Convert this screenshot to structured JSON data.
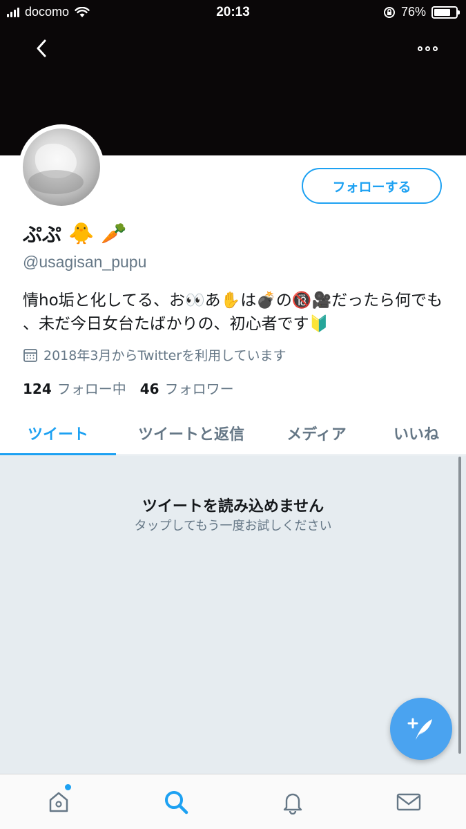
{
  "status_bar": {
    "carrier": "docomo",
    "time": "20:13",
    "battery": "76%",
    "battery_level": 0.76
  },
  "header": {
    "back_icon": "chevron-left-icon",
    "more_icon": "ellipsis-icon"
  },
  "profile": {
    "follow_button": "フォローする",
    "display_name": "ぷぷ",
    "name_emoji": [
      "🐥",
      "🥕"
    ],
    "handle": "@usagisan_pupu",
    "bio": "情ho垢と化してる、お👀あ✋は💣の🔞🎥だったら何でも 、未だ今日女台たばかりの、初心者です🔰",
    "joined": "2018年3月からTwitterを利用しています",
    "following_count": "124",
    "following_label": "フォロー中",
    "followers_count": "46",
    "followers_label": "フォロワー"
  },
  "tabs": [
    {
      "label": "ツイート",
      "active": true
    },
    {
      "label": "ツイートと返信",
      "active": false
    },
    {
      "label": "メディア",
      "active": false
    },
    {
      "label": "いいね",
      "active": false
    }
  ],
  "content": {
    "title": "ツイートを読み込めません",
    "subtitle": "タップしてもう一度お試しください"
  },
  "compose_icon": "compose-feather-icon",
  "bottom_nav": [
    {
      "name": "home-icon",
      "has_dot": true
    },
    {
      "name": "search-icon",
      "active": true
    },
    {
      "name": "bell-icon"
    },
    {
      "name": "mail-icon"
    }
  ],
  "colors": {
    "accent": "#1da1f2",
    "banner": "#0a0708",
    "content_bg": "#e6ecf0"
  }
}
